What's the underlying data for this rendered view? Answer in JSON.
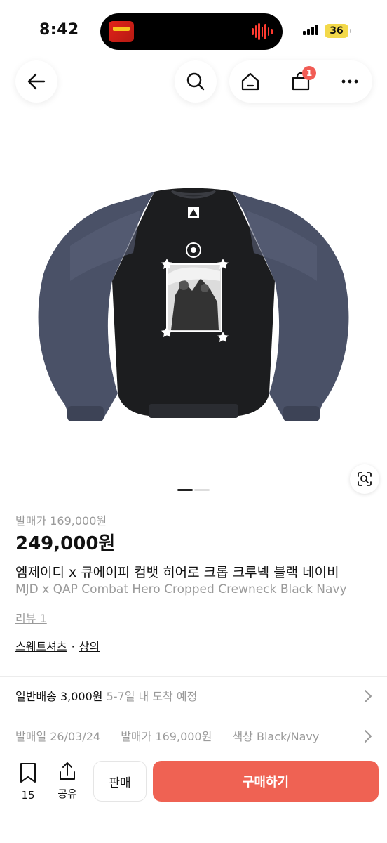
{
  "status": {
    "time": "8:42",
    "battery": "36"
  },
  "nav": {
    "cart_badge": "1"
  },
  "product": {
    "release_price_label": "발매가 169,000원",
    "price": "249,000원",
    "title_ko": "엠제이디 x 큐에이피 컴뱃 히어로 크롭 크루넥 블랙 네이비",
    "title_en": "MJD x QAP Combat Hero Cropped Crewneck Black Navy",
    "review": "리뷰 1",
    "category": [
      "스웨트셔츠",
      "상의"
    ],
    "category_separator": "·",
    "image_pages": 2,
    "image_active_page": 1
  },
  "shipping": {
    "label": "일반배송 3,000원",
    "eta": "5-7일 내 도착 예정"
  },
  "meta": {
    "release_date": "발매일 26/03/24",
    "release_price": "발매가 169,000원",
    "color": "색상 Black/Navy"
  },
  "bottom": {
    "bookmark_count": "15",
    "share_label": "공유",
    "sell_label": "판매",
    "buy_label": "구매하기"
  },
  "colors": {
    "accent": "#ef6253",
    "badge": "#f15c55",
    "sweater_body": "#1c1d1f",
    "sweater_sleeve": "#4a5167"
  }
}
